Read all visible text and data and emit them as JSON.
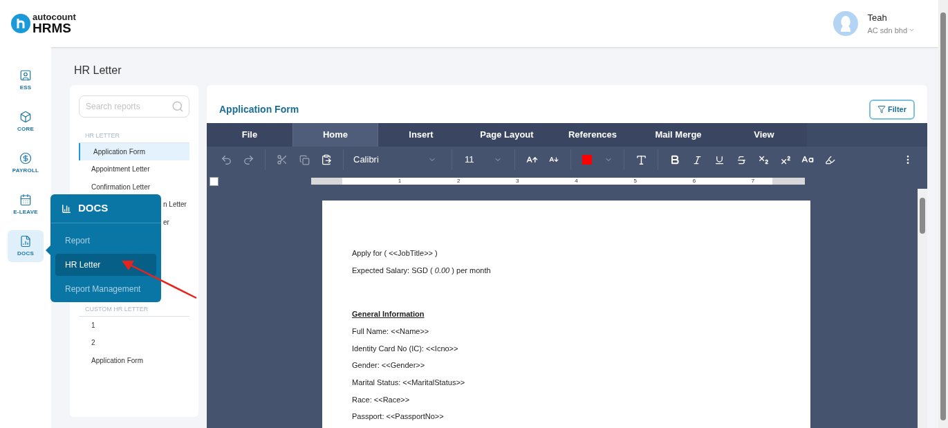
{
  "app": {
    "logo_small": "autocount",
    "logo_name": "HRMS"
  },
  "user": {
    "name": "Teah",
    "company": "AC sdn bhd"
  },
  "nav": [
    {
      "label": "ESS",
      "selected": false
    },
    {
      "label": "CORE",
      "selected": false
    },
    {
      "label": "PAYROLL",
      "selected": false
    },
    {
      "label": "E-LEAVE",
      "selected": false
    },
    {
      "label": "DOCS",
      "selected": true
    }
  ],
  "page_title": "HR Letter",
  "search": {
    "placeholder": "Search reports"
  },
  "sections": [
    {
      "heading": "HR LETTER",
      "items": [
        {
          "label": "Application Form",
          "selected": true,
          "kind": "full"
        },
        {
          "label": "Appointment Letter",
          "selected": false,
          "kind": "full"
        },
        {
          "label": "Confirmation Letter",
          "selected": false,
          "kind": "full"
        },
        {
          "label": "n Letter",
          "selected": false,
          "kind": "partial"
        },
        {
          "label": "er",
          "selected": false,
          "kind": "partial"
        }
      ]
    },
    {
      "heading": "CUSTOM HR LETTER",
      "items": [
        {
          "label": "1",
          "selected": false,
          "kind": "full"
        },
        {
          "label": "2",
          "selected": false,
          "kind": "full"
        },
        {
          "label": "Application Form",
          "selected": false,
          "kind": "full"
        }
      ]
    }
  ],
  "flyout": {
    "title": "DOCS",
    "items": [
      {
        "label": "Report",
        "selected": false
      },
      {
        "label": "HR Letter",
        "selected": true
      },
      {
        "label": "Report Management",
        "selected": false
      }
    ]
  },
  "editor": {
    "title": "Application Form",
    "filter_button": "Filter",
    "tabs": [
      {
        "label": "File",
        "selected": false
      },
      {
        "label": "Home",
        "selected": true
      },
      {
        "label": "Insert",
        "selected": false
      },
      {
        "label": "Page Layout",
        "selected": false
      },
      {
        "label": "References",
        "selected": false
      },
      {
        "label": "Mail Merge",
        "selected": false
      },
      {
        "label": "View",
        "selected": false
      }
    ],
    "font": "Calibri",
    "font_size": "11",
    "ruler": [
      "1",
      "2",
      "3",
      "4",
      "5",
      "6",
      "7"
    ],
    "document": [
      {
        "kind": "line",
        "text": "Apply for (  <<JobTitle>> )"
      },
      {
        "kind": "line",
        "text": "Expected Salary: SGD ( *0.00* ) per month"
      },
      {
        "kind": "gap"
      },
      {
        "kind": "heading",
        "text": "General Information"
      },
      {
        "kind": "line",
        "text": "Full Name: <<Name>>"
      },
      {
        "kind": "line",
        "text": "Identity Card No (IC): <<Icno>>"
      },
      {
        "kind": "line",
        "text": "Gender: <<Gender>>"
      },
      {
        "kind": "line",
        "text": "Marital Status: <<MaritalStatus>>"
      },
      {
        "kind": "line",
        "text": "Race: <<Race>>"
      },
      {
        "kind": "line",
        "text": "Passport: <<PassportNo>>"
      }
    ]
  }
}
